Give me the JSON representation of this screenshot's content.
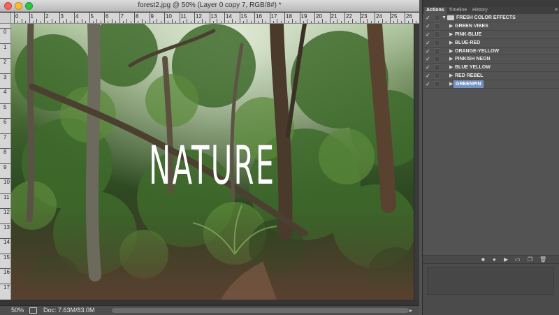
{
  "window": {
    "title": "forest2.jpg @ 50% (Layer 0 copy 7, RGB/8#) *"
  },
  "canvas": {
    "overlay_text": "NATURE"
  },
  "rulers": {
    "top_labels": [
      "0",
      "1",
      "2",
      "3",
      "4",
      "5",
      "6",
      "7",
      "8",
      "9",
      "10",
      "11",
      "12",
      "13",
      "14",
      "15",
      "16",
      "17",
      "18",
      "19",
      "20",
      "21",
      "22",
      "23",
      "24",
      "25",
      "26"
    ],
    "left_labels": [
      "0",
      "1",
      "2",
      "3",
      "4",
      "5",
      "6",
      "7",
      "8",
      "9",
      "10",
      "11",
      "12",
      "13",
      "14",
      "15",
      "16",
      "17"
    ]
  },
  "status": {
    "zoom": "50%",
    "doc_size": "Doc: 7.63M/83.0M"
  },
  "panel": {
    "tabs": [
      "Actions",
      "Timeline",
      "History"
    ],
    "active_tab": "Actions",
    "action_set": "FRESH COLOR EFFECTS",
    "actions": [
      {
        "label": "GREEN VIBES",
        "selected": false
      },
      {
        "label": "PINK-BLUE",
        "selected": false
      },
      {
        "label": "BLUE-RED",
        "selected": false
      },
      {
        "label": "ORANGE-YELLOW",
        "selected": false
      },
      {
        "label": "PINKISH NEON",
        "selected": false
      },
      {
        "label": "BLUE YELLOW",
        "selected": false
      },
      {
        "label": "RED REBEL",
        "selected": false
      },
      {
        "label": "GREENPIN",
        "selected": true
      }
    ],
    "check_glyph": "✓",
    "expand_glyph": "▶",
    "set_expand_glyph": "▼",
    "toolbar": [
      "stop-icon",
      "record-icon",
      "play-icon",
      "new-set-icon",
      "new-action-icon",
      "trash-icon"
    ]
  }
}
